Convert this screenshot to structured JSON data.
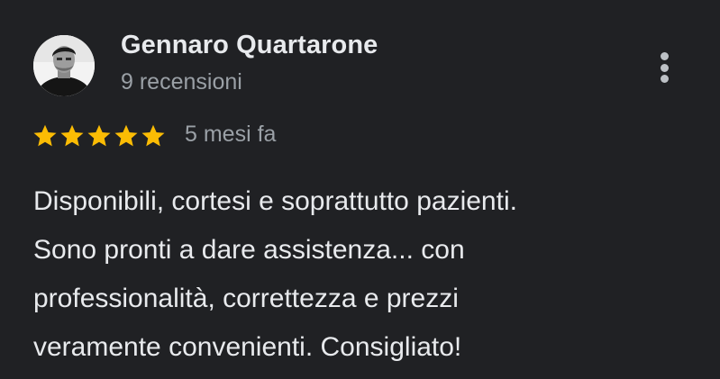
{
  "review": {
    "author_name": "Gennaro Quartarone",
    "review_count": "9 recensioni",
    "rating": 5,
    "rating_max": 5,
    "star_color": "#fbbc04",
    "date": "5 mesi fa",
    "text_lines": [
      "Disponibili, cortesi e soprattutto pazienti.",
      "Sono pronti a dare assistenza... con",
      "professionalità, correttezza e prezzi",
      "veramente convenienti. Consigliato!"
    ],
    "more_icon": "more-vert-icon",
    "star_icon": "star-icon",
    "avatar_icon": "user-photo"
  },
  "colors": {
    "background": "#202124",
    "primary_text": "#e8eaed",
    "secondary_text": "#9aa0a6"
  }
}
